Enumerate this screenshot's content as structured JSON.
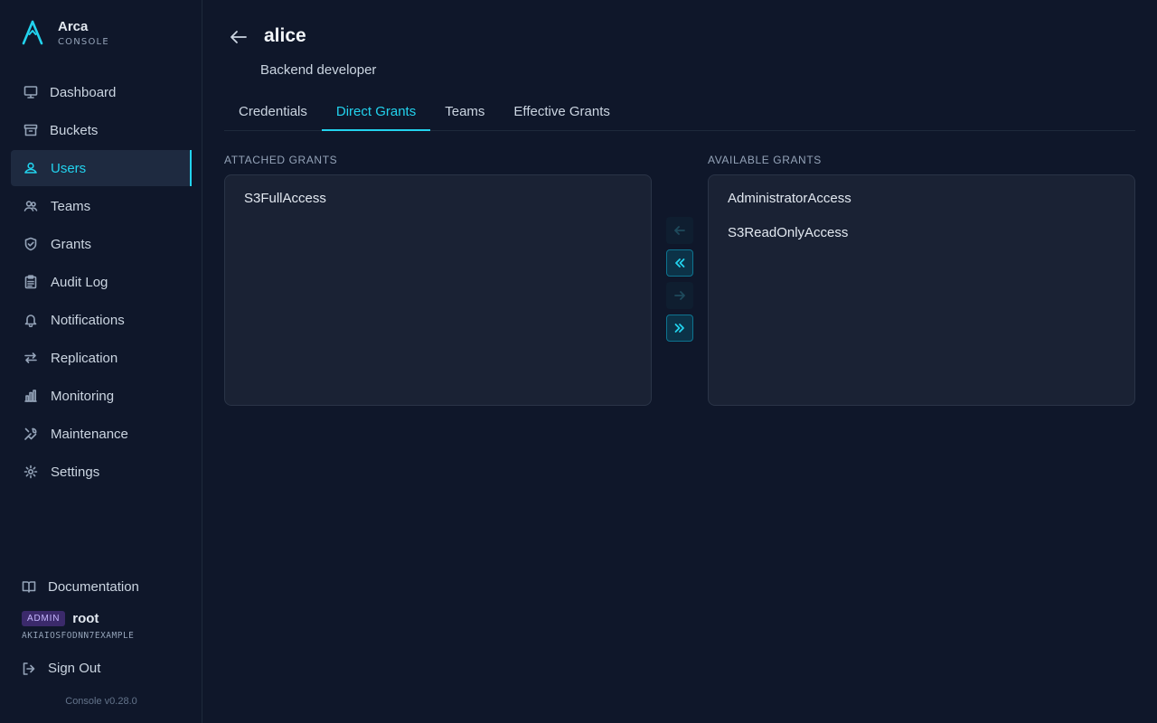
{
  "brand": {
    "name": "Arca",
    "subtitle": "CONSOLE"
  },
  "sidebar": {
    "items": [
      {
        "label": "Dashboard",
        "icon": "monitor-icon",
        "active": false
      },
      {
        "label": "Buckets",
        "icon": "archive-icon",
        "active": false
      },
      {
        "label": "Users",
        "icon": "user-icon",
        "active": true
      },
      {
        "label": "Teams",
        "icon": "users-icon",
        "active": false
      },
      {
        "label": "Grants",
        "icon": "shield-check-icon",
        "active": false
      },
      {
        "label": "Audit Log",
        "icon": "clipboard-icon",
        "active": false
      },
      {
        "label": "Notifications",
        "icon": "bell-icon",
        "active": false
      },
      {
        "label": "Replication",
        "icon": "arrows-left-right-icon",
        "active": false
      },
      {
        "label": "Monitoring",
        "icon": "bar-chart-icon",
        "active": false
      },
      {
        "label": "Maintenance",
        "icon": "wrench-icon",
        "active": false
      },
      {
        "label": "Settings",
        "icon": "gear-icon",
        "active": false
      }
    ],
    "documentation": "Documentation",
    "user": {
      "badge": "ADMIN",
      "name": "root",
      "access_key": "AKIAIOSFODNN7EXAMPLE"
    },
    "sign_out": "Sign Out",
    "version": "Console v0.28.0"
  },
  "header": {
    "title": "alice",
    "subtitle": "Backend developer"
  },
  "tabs": [
    {
      "label": "Credentials",
      "active": false
    },
    {
      "label": "Direct Grants",
      "active": true
    },
    {
      "label": "Teams",
      "active": false
    },
    {
      "label": "Effective Grants",
      "active": false
    }
  ],
  "attached": {
    "label": "ATTACHED GRANTS",
    "items": [
      "S3FullAccess"
    ]
  },
  "available": {
    "label": "AVAILABLE GRANTS",
    "items": [
      "AdministratorAccess",
      "S3ReadOnlyAccess"
    ]
  },
  "move_buttons": [
    {
      "name": "move-selected-left-button",
      "icon": "arrow-left-icon",
      "enabled": false
    },
    {
      "name": "move-all-left-button",
      "icon": "chevrons-left-icon",
      "enabled": true
    },
    {
      "name": "move-selected-right-button",
      "icon": "arrow-right-icon",
      "enabled": false
    },
    {
      "name": "move-all-right-button",
      "icon": "chevrons-right-icon",
      "enabled": true
    }
  ],
  "colors": {
    "accent": "#22d3ee",
    "background": "#0f172a",
    "panel": "#1a2234",
    "badge": "#3b2a6b"
  }
}
